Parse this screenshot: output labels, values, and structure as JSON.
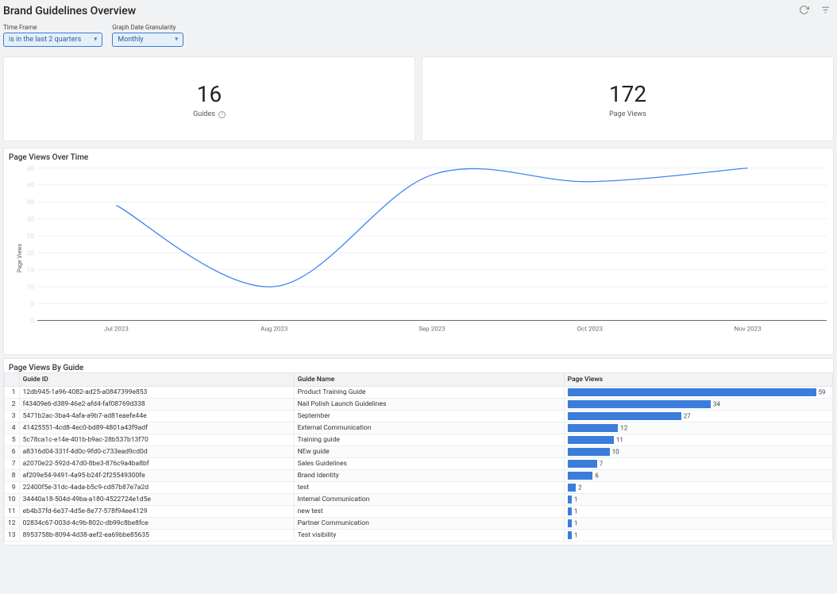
{
  "header": {
    "title": "Brand Guidelines Overview"
  },
  "filters": {
    "timeframe_label": "Time Frame",
    "timeframe_value": "is in the last 2 quarters",
    "granularity_label": "Graph Date Granularity",
    "granularity_value": "Monthly"
  },
  "kpis": {
    "guides_value": "16",
    "guides_label": "Guides",
    "views_value": "172",
    "views_label": "Page Views"
  },
  "line_panel": {
    "title": "Page Views Over Time",
    "ylabel": "Page Views"
  },
  "chart_data": {
    "type": "line",
    "title": "Page Views Over Time",
    "xlabel": "",
    "ylabel": "Page Views",
    "x": [
      "Jul 2023",
      "Aug 2023",
      "Sep 2023",
      "Oct 2023",
      "Nov 2023"
    ],
    "y": [
      34,
      10,
      43,
      41,
      45
    ],
    "ylim": [
      0,
      45
    ],
    "y_ticks": [
      0,
      5,
      10,
      15,
      20,
      25,
      30,
      35,
      40,
      45
    ]
  },
  "table_panel": {
    "title": "Page Views By Guide",
    "columns": {
      "id": "Guide ID",
      "name": "Guide Name",
      "views": "Page Views"
    },
    "rows": [
      {
        "idx": 1,
        "id": "12db945-1a96-4082-ad25-a0847399e853",
        "name": "Product Training Guide",
        "views": 59
      },
      {
        "idx": 2,
        "id": "f43409e6-d389-46e2-afd4-faf08769d338",
        "name": "Nail Polish Launch Guidelines",
        "views": 34
      },
      {
        "idx": 3,
        "id": "5471b2ac-3ba4-4afa-a9b7-ad81eaefe44e",
        "name": "September",
        "views": 27
      },
      {
        "idx": 4,
        "id": "41425551-4cd8-4ec0-bd89-4801a43f9adf",
        "name": "External Communication",
        "views": 12
      },
      {
        "idx": 5,
        "id": "5c78ca1c-e14e-401b-b9ac-28b537b13f70",
        "name": "Training guide",
        "views": 11
      },
      {
        "idx": 6,
        "id": "a8316d04-331f-4d0c-9fd0-c733ead9cd0d",
        "name": "NEw guide",
        "views": 10
      },
      {
        "idx": 7,
        "id": "a2070e22-592d-47d0-8be3-876c9a4ba8bf",
        "name": "Sales Guidelines",
        "views": 7
      },
      {
        "idx": 8,
        "id": "af209e54-9491-4a95-b24f-2f25549300fe",
        "name": "Brand Identity",
        "views": 6
      },
      {
        "idx": 9,
        "id": "22400f5e-31dc-4ada-b5c9-cd87b87e7a2d",
        "name": "test",
        "views": 2
      },
      {
        "idx": 10,
        "id": "34440a18-504d-49ba-a180-4522724e1d5e",
        "name": "Internal Communication",
        "views": 1
      },
      {
        "idx": 11,
        "id": "eb4b37fd-6e37-4d5e-8e77-578f94ee4129",
        "name": "new test",
        "views": 1
      },
      {
        "idx": 12,
        "id": "02834c67-003d-4c9b-802c-db99c8be8fce",
        "name": "Partner Communication",
        "views": 1
      },
      {
        "idx": 13,
        "id": "8953758b-8094-4d38-aef2-ea69bbe85635",
        "name": "Test visibility",
        "views": 1
      }
    ]
  }
}
